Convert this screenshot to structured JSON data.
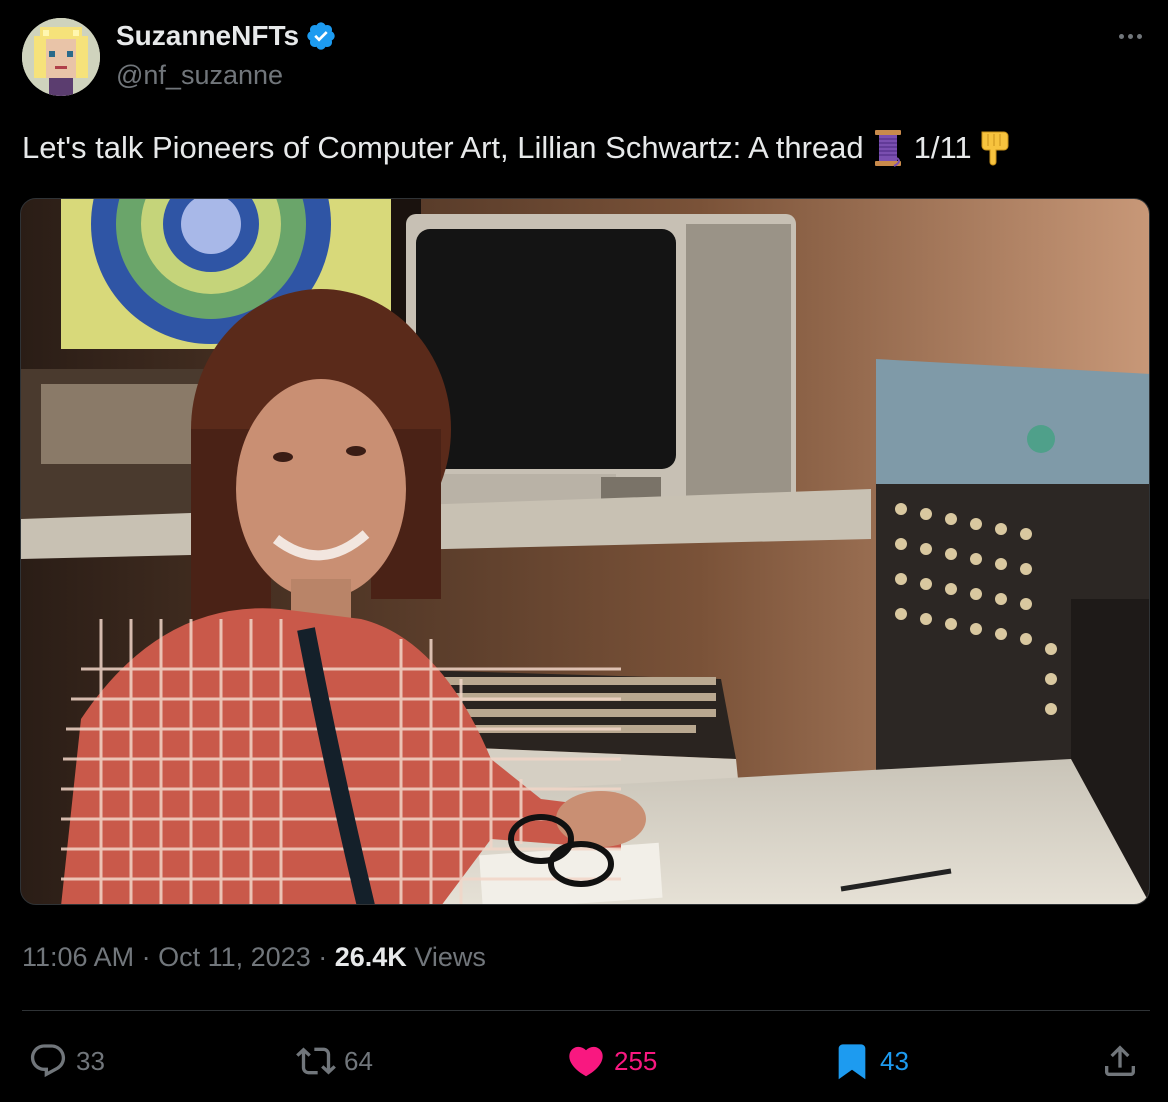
{
  "author": {
    "display_name": "SuzanneNFTs",
    "handle": "@nf_suzanne",
    "verified": true,
    "avatar_icon": "pixel-art-avatar"
  },
  "tweet": {
    "text": "Let's talk Pioneers of Computer Art, Lillian Schwartz: A thread",
    "thread_marker": "1/11",
    "emoji_1": "spool-of-thread-emoji",
    "emoji_2": "pointing-down-hand-emoji"
  },
  "media": {
    "kind": "photo",
    "subject": "Lillian Schwartz at computer workstation"
  },
  "meta": {
    "time": "11:06 AM",
    "separator": "·",
    "date": "Oct 11, 2023",
    "views_count": "26.4K",
    "views_label": "Views"
  },
  "actions": {
    "reply_count": "33",
    "retweet_count": "64",
    "like_count": "255",
    "bookmark_count": "43"
  },
  "colors": {
    "background": "#000000",
    "text_primary": "#e7e9ea",
    "text_secondary": "#71767b",
    "like_active": "#f91880",
    "bookmark_active": "#1d9bf0",
    "verified_badge": "#1d9bf0"
  }
}
